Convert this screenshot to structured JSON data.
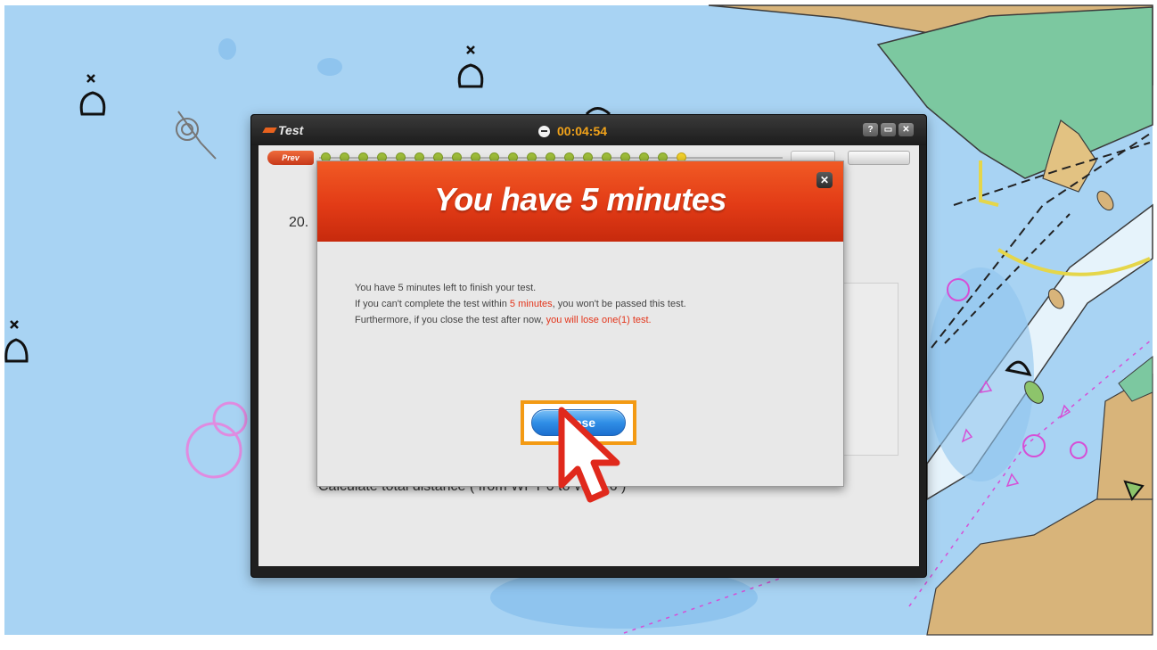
{
  "window": {
    "title": "Test",
    "timer": "00:04:54",
    "controls": [
      "?",
      "▭",
      "✕"
    ]
  },
  "nav": {
    "prev_label": "Prev",
    "progress_total": 20,
    "progress_current": 20
  },
  "question": {
    "number": "20.",
    "text": "Calculate total distance ( from WPT 0 to WPT 6 )"
  },
  "modal": {
    "title": "You have 5 minutes",
    "close_icon": "✕",
    "line1": "You have 5 minutes left to finish your test.",
    "line2_a": "If you can't complete the test within ",
    "line2_hl": "5 minutes",
    "line2_b": ", you won't be passed this test.",
    "line3_a": "Furthermore, if you close the test after now, ",
    "line3_hl": "you will lose one(1) test.",
    "close_button": "Close"
  },
  "colors": {
    "accent_orange": "#f15a24",
    "timer_orange": "#f2a31a",
    "highlight_red": "#e3341a",
    "frame_orange": "#f39a13",
    "button_blue": "#2f8ee6",
    "water": "#a8d3f3",
    "land": "#d8b47a",
    "green_land": "#7cc8a0"
  },
  "icons": [
    "bell-buoy-icon",
    "clock-icon",
    "help-icon",
    "restore-icon",
    "close-icon",
    "pointer-cursor-icon"
  ]
}
